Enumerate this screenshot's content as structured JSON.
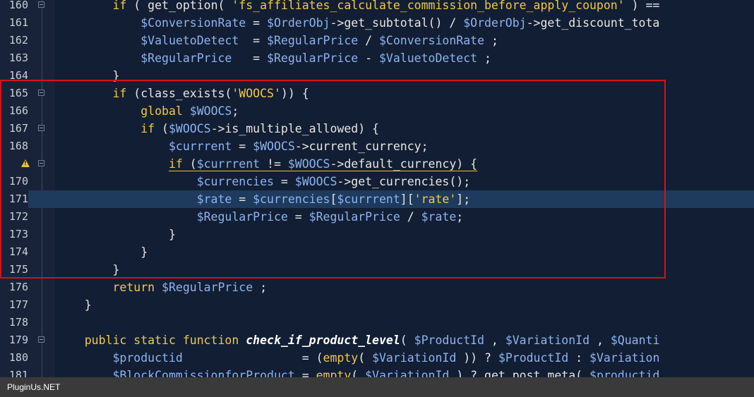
{
  "lines": [
    {
      "num": "160",
      "fold": true,
      "current": false,
      "warn": false,
      "indent": "        ",
      "tokens": [
        {
          "t": "kw",
          "v": "if"
        },
        {
          "t": "plain",
          "v": " ( get_option( "
        },
        {
          "t": "str",
          "v": "'fs_affiliates_calculate_commission_before_apply_coupon'"
        },
        {
          "t": "plain",
          "v": " ) =="
        }
      ]
    },
    {
      "num": "161",
      "fold": false,
      "current": false,
      "warn": false,
      "indent": "            ",
      "tokens": [
        {
          "t": "var",
          "v": "$ConversionRate"
        },
        {
          "t": "plain",
          "v": " = "
        },
        {
          "t": "var",
          "v": "$OrderObj"
        },
        {
          "t": "plain",
          "v": "->get_subtotal() / "
        },
        {
          "t": "var",
          "v": "$OrderObj"
        },
        {
          "t": "plain",
          "v": "->get_discount_tota"
        }
      ]
    },
    {
      "num": "162",
      "fold": false,
      "current": false,
      "warn": false,
      "indent": "            ",
      "tokens": [
        {
          "t": "var",
          "v": "$ValuetoDetect"
        },
        {
          "t": "plain",
          "v": "  = "
        },
        {
          "t": "var",
          "v": "$RegularPrice"
        },
        {
          "t": "plain",
          "v": " / "
        },
        {
          "t": "var",
          "v": "$ConversionRate"
        },
        {
          "t": "plain",
          "v": " ;"
        }
      ]
    },
    {
      "num": "163",
      "fold": false,
      "current": false,
      "warn": false,
      "indent": "            ",
      "tokens": [
        {
          "t": "var",
          "v": "$RegularPrice"
        },
        {
          "t": "plain",
          "v": "   = "
        },
        {
          "t": "var",
          "v": "$RegularPrice"
        },
        {
          "t": "plain",
          "v": " - "
        },
        {
          "t": "var",
          "v": "$ValuetoDetect"
        },
        {
          "t": "plain",
          "v": " ;"
        }
      ]
    },
    {
      "num": "164",
      "fold": false,
      "current": false,
      "warn": false,
      "indent": "        ",
      "tokens": [
        {
          "t": "plain",
          "v": "}"
        }
      ]
    },
    {
      "num": "165",
      "fold": true,
      "current": false,
      "warn": false,
      "indent": "        ",
      "tokens": [
        {
          "t": "kw",
          "v": "if"
        },
        {
          "t": "plain",
          "v": " (class_exists("
        },
        {
          "t": "str",
          "v": "'WOOCS'"
        },
        {
          "t": "plain",
          "v": ")) {"
        }
      ]
    },
    {
      "num": "166",
      "fold": false,
      "current": false,
      "warn": false,
      "indent": "            ",
      "tokens": [
        {
          "t": "kw",
          "v": "global"
        },
        {
          "t": "plain",
          "v": " "
        },
        {
          "t": "var",
          "v": "$WOOCS"
        },
        {
          "t": "plain",
          "v": ";"
        }
      ]
    },
    {
      "num": "167",
      "fold": true,
      "current": false,
      "warn": false,
      "indent": "            ",
      "tokens": [
        {
          "t": "kw",
          "v": "if"
        },
        {
          "t": "plain",
          "v": " ("
        },
        {
          "t": "var",
          "v": "$WOOCS"
        },
        {
          "t": "plain",
          "v": "->is_multiple_allowed) {"
        }
      ]
    },
    {
      "num": "168",
      "fold": false,
      "current": false,
      "warn": false,
      "indent": "                ",
      "tokens": [
        {
          "t": "var",
          "v": "$currrent"
        },
        {
          "t": "plain",
          "v": " = "
        },
        {
          "t": "var",
          "v": "$WOOCS"
        },
        {
          "t": "plain",
          "v": "->current_currency;"
        }
      ]
    },
    {
      "num": "",
      "fold": true,
      "current": false,
      "warn": true,
      "indent": "                ",
      "underline": true,
      "tokens": [
        {
          "t": "kw",
          "v": "if"
        },
        {
          "t": "plain",
          "v": " ("
        },
        {
          "t": "var",
          "v": "$currrent"
        },
        {
          "t": "plain",
          "v": " != "
        },
        {
          "t": "var",
          "v": "$WOOCS"
        },
        {
          "t": "plain",
          "v": "->default_currency) {"
        }
      ]
    },
    {
      "num": "170",
      "fold": false,
      "current": false,
      "warn": false,
      "indent": "                    ",
      "tokens": [
        {
          "t": "var",
          "v": "$currencies"
        },
        {
          "t": "plain",
          "v": " = "
        },
        {
          "t": "var",
          "v": "$WOOCS"
        },
        {
          "t": "plain",
          "v": "->get_currencies();"
        }
      ]
    },
    {
      "num": "171",
      "fold": false,
      "current": true,
      "warn": false,
      "indent": "                    ",
      "tokens": [
        {
          "t": "var",
          "v": "$rate"
        },
        {
          "t": "plain",
          "v": " = "
        },
        {
          "t": "var",
          "v": "$currencies"
        },
        {
          "t": "plain",
          "v": "["
        },
        {
          "t": "var",
          "v": "$currrent"
        },
        {
          "t": "plain",
          "v": "]["
        },
        {
          "t": "str",
          "v": "'rate'"
        },
        {
          "t": "plain",
          "v": "];"
        }
      ]
    },
    {
      "num": "172",
      "fold": false,
      "current": false,
      "warn": false,
      "indent": "                    ",
      "tokens": [
        {
          "t": "var",
          "v": "$RegularPrice"
        },
        {
          "t": "plain",
          "v": " = "
        },
        {
          "t": "var",
          "v": "$RegularPrice"
        },
        {
          "t": "plain",
          "v": " / "
        },
        {
          "t": "var",
          "v": "$rate"
        },
        {
          "t": "plain",
          "v": ";"
        }
      ]
    },
    {
      "num": "173",
      "fold": false,
      "current": false,
      "warn": false,
      "indent": "                ",
      "tokens": [
        {
          "t": "plain",
          "v": "}"
        }
      ]
    },
    {
      "num": "174",
      "fold": false,
      "current": false,
      "warn": false,
      "indent": "            ",
      "tokens": [
        {
          "t": "plain",
          "v": "}"
        }
      ]
    },
    {
      "num": "175",
      "fold": false,
      "current": false,
      "warn": false,
      "indent": "        ",
      "tokens": [
        {
          "t": "plain",
          "v": "}"
        }
      ]
    },
    {
      "num": "176",
      "fold": false,
      "current": false,
      "warn": false,
      "indent": "        ",
      "tokens": [
        {
          "t": "kw",
          "v": "return"
        },
        {
          "t": "plain",
          "v": " "
        },
        {
          "t": "var",
          "v": "$RegularPrice"
        },
        {
          "t": "plain",
          "v": " ;"
        }
      ]
    },
    {
      "num": "177",
      "fold": false,
      "current": false,
      "warn": false,
      "indent": "    ",
      "tokens": [
        {
          "t": "plain",
          "v": "}"
        }
      ]
    },
    {
      "num": "178",
      "fold": false,
      "current": false,
      "warn": false,
      "indent": "",
      "tokens": []
    },
    {
      "num": "179",
      "fold": true,
      "current": false,
      "warn": false,
      "indent": "    ",
      "tokens": [
        {
          "t": "kw",
          "v": "public static function"
        },
        {
          "t": "plain",
          "v": " "
        },
        {
          "t": "fn",
          "v": "check_if_product_level"
        },
        {
          "t": "plain",
          "v": "( "
        },
        {
          "t": "var",
          "v": "$ProductId"
        },
        {
          "t": "plain",
          "v": " , "
        },
        {
          "t": "var",
          "v": "$VariationId"
        },
        {
          "t": "plain",
          "v": " , "
        },
        {
          "t": "var",
          "v": "$Quanti"
        }
      ]
    },
    {
      "num": "180",
      "fold": false,
      "current": false,
      "warn": false,
      "indent": "        ",
      "tokens": [
        {
          "t": "var",
          "v": "$productid"
        },
        {
          "t": "plain",
          "v": "                 = ("
        },
        {
          "t": "kw",
          "v": "empty"
        },
        {
          "t": "plain",
          "v": "( "
        },
        {
          "t": "var",
          "v": "$VariationId"
        },
        {
          "t": "plain",
          "v": " )) ? "
        },
        {
          "t": "var",
          "v": "$ProductId"
        },
        {
          "t": "plain",
          "v": " : "
        },
        {
          "t": "var",
          "v": "$Variation"
        }
      ]
    },
    {
      "num": "181",
      "fold": false,
      "current": false,
      "warn": false,
      "indent": "        ",
      "tokens": [
        {
          "t": "var",
          "v": "$BlockCommissionforProduct"
        },
        {
          "t": "plain",
          "v": " = "
        },
        {
          "t": "kw",
          "v": "empty"
        },
        {
          "t": "plain",
          "v": "( "
        },
        {
          "t": "var",
          "v": "$VariationId"
        },
        {
          "t": "plain",
          "v": " ) ? get_post_meta( "
        },
        {
          "t": "var",
          "v": "$productid"
        }
      ]
    }
  ],
  "warning_icon": "warning-triangle-icon",
  "fold_icon": "fold-toggle-icon",
  "highlight_color": "#d8101a",
  "status_bar": {
    "text": "PluginUs.NET"
  }
}
